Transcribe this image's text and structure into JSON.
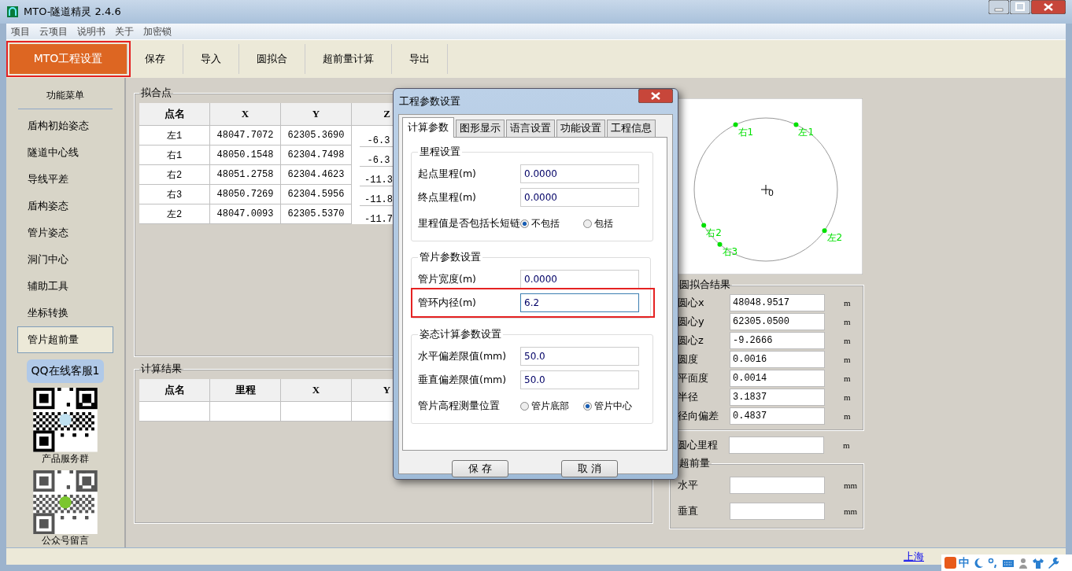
{
  "window": {
    "title": "MTO-隧道精灵 2.4.6"
  },
  "menu": [
    "项目",
    "云项目",
    "说明书",
    "关于",
    "加密锁"
  ],
  "toolbar": [
    {
      "label": "MTO工程设置",
      "selected": true,
      "highlighted": true
    },
    {
      "label": "保存",
      "selected": false,
      "highlighted": false
    },
    {
      "label": "导入",
      "selected": false,
      "highlighted": false
    },
    {
      "label": "圆拟合",
      "selected": false,
      "highlighted": false
    },
    {
      "label": "超前量计算",
      "selected": false,
      "highlighted": false
    },
    {
      "label": "导出",
      "selected": false,
      "highlighted": false
    }
  ],
  "sidebar": {
    "title": "功能菜单",
    "items": [
      {
        "label": "盾构初始姿态",
        "selected": false
      },
      {
        "label": "隧道中心线",
        "selected": false
      },
      {
        "label": "导线平差",
        "selected": false
      },
      {
        "label": "盾构姿态",
        "selected": false
      },
      {
        "label": "管片姿态",
        "selected": false
      },
      {
        "label": "洞门中心",
        "selected": false
      },
      {
        "label": "辅助工具",
        "selected": false
      },
      {
        "label": "坐标转换",
        "selected": false
      },
      {
        "label": "管片超前量",
        "selected": true
      }
    ],
    "qq_button": "QQ在线客服1",
    "qr_captions": [
      "产品服务群",
      "公众号留言"
    ]
  },
  "fit_points": {
    "title": "拟合点",
    "columns": [
      "点名",
      "X",
      "Y",
      "Z"
    ],
    "rows": [
      [
        "左1",
        "48047.7072",
        "62305.3690",
        "-6.3"
      ],
      [
        "右1",
        "48050.1548",
        "62304.7498",
        "-6.3"
      ],
      [
        "右2",
        "48051.2758",
        "62304.4623",
        "-11.3"
      ],
      [
        "右3",
        "48050.7269",
        "62304.5956",
        "-11.8"
      ],
      [
        "左2",
        "48047.0093",
        "62305.5370",
        "-11.7"
      ]
    ]
  },
  "results": {
    "title": "计算结果",
    "columns": [
      "点名",
      "里程",
      "X",
      "Y"
    ]
  },
  "plot": {
    "points": [
      "右1",
      "左1",
      "右2",
      "右3",
      "左2"
    ],
    "center_label": "0"
  },
  "circle_fit": {
    "title": "圆拟合结果",
    "fields": [
      {
        "label": "圆心x",
        "value": "48048.9517",
        "unit": "m"
      },
      {
        "label": "圆心y",
        "value": "62305.0500",
        "unit": "m"
      },
      {
        "label": "圆心z",
        "value": "-9.2666",
        "unit": "m"
      },
      {
        "label": "圆度",
        "value": "0.0016",
        "unit": "m"
      },
      {
        "label": "平面度",
        "value": "0.0014",
        "unit": "m"
      },
      {
        "label": "半径",
        "value": "3.1837",
        "unit": "m"
      },
      {
        "label": "径向偏差",
        "value": "0.4837",
        "unit": "m"
      }
    ]
  },
  "center_mileage": {
    "label": "圆心里程",
    "unit": "m"
  },
  "overbreak": {
    "title": "超前量",
    "fields": [
      {
        "label": "水平",
        "unit": "mm"
      },
      {
        "label": "垂直",
        "unit": "mm"
      }
    ]
  },
  "dialog": {
    "title": "工程参数设置",
    "tabs": [
      {
        "label": "计算参数",
        "selected": true
      },
      {
        "label": "图形显示",
        "selected": false
      },
      {
        "label": "语言设置",
        "selected": false
      },
      {
        "label": "功能设置",
        "selected": false
      },
      {
        "label": "工程信息",
        "selected": false
      }
    ],
    "groups": [
      {
        "title": "里程设置",
        "rows": [
          {
            "kind": "field",
            "label": "起点里程(m)",
            "value": "0.0000",
            "highlighted": false
          },
          {
            "kind": "field",
            "label": "终点里程(m)",
            "value": "0.0000",
            "highlighted": false
          },
          {
            "kind": "radio",
            "label": "里程值是否包括长短链",
            "options": [
              {
                "label": "不包括",
                "selected": true
              },
              {
                "label": "包括",
                "selected": false
              }
            ]
          }
        ]
      },
      {
        "title": "管片参数设置",
        "rows": [
          {
            "kind": "field",
            "label": "管片宽度(m)",
            "value": "0.0000",
            "highlighted": false
          },
          {
            "kind": "field",
            "label": "管环内径(m)",
            "value": "6.2",
            "highlighted": true
          }
        ]
      },
      {
        "title": "姿态计算参数设置",
        "rows": [
          {
            "kind": "field",
            "label": "水平偏差限值(mm)",
            "value": "50.0",
            "highlighted": false
          },
          {
            "kind": "field",
            "label": "垂直偏差限值(mm)",
            "value": "50.0",
            "highlighted": false
          },
          {
            "kind": "radio",
            "label": "管片高程测量位置",
            "options": [
              {
                "label": "管片底部",
                "selected": false
              },
              {
                "label": "管片中心",
                "selected": true
              }
            ]
          }
        ]
      }
    ],
    "buttons": [
      "保 存",
      "取 消"
    ]
  },
  "status_bar": {
    "link": "上海"
  },
  "ime_bar": {
    "label": "中"
  }
}
